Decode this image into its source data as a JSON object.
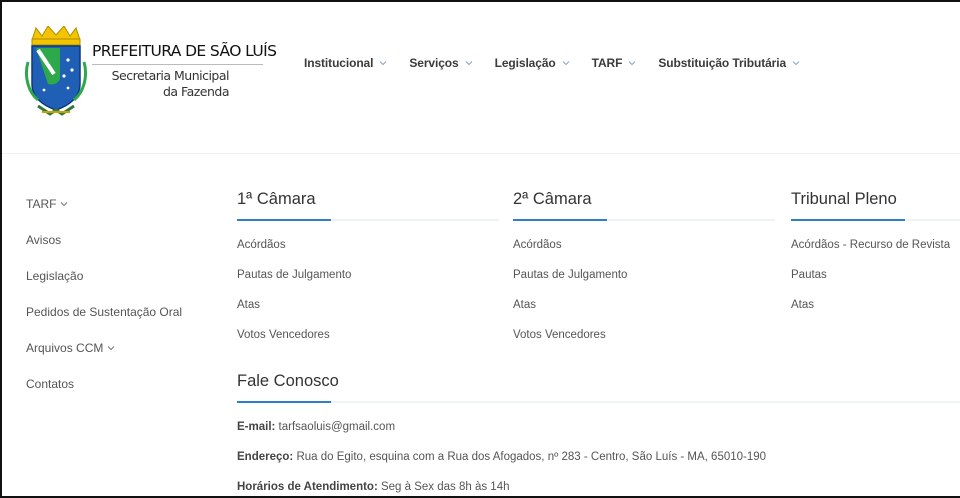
{
  "header": {
    "brand_title": "PREFEITURA DE SÃO LUÍS",
    "brand_sub_1": "Secretaria Municipal",
    "brand_sub_2": "da Fazenda",
    "logo_icon": "sao-luis-coat-of-arms",
    "nav": [
      {
        "label": "Institucional"
      },
      {
        "label": "Serviços"
      },
      {
        "label": "Legislação"
      },
      {
        "label": "TARF"
      },
      {
        "label": "Substituição Tributária"
      }
    ]
  },
  "sidebar": {
    "items": [
      {
        "label": "TARF",
        "has_chevron": true
      },
      {
        "label": "Avisos"
      },
      {
        "label": "Legislação"
      },
      {
        "label": "Pedidos de Sustentação Oral"
      },
      {
        "label": "Arquivos CCM",
        "has_chevron": true
      },
      {
        "label": "Contatos"
      }
    ]
  },
  "columns": [
    {
      "title": "1ª Câmara",
      "links": [
        "Acórdãos",
        "Pautas de Julgamento",
        "Atas",
        "Votos Vencedores"
      ]
    },
    {
      "title": "2ª Câmara",
      "links": [
        "Acórdãos",
        "Pautas de Julgamento",
        "Atas",
        "Votos Vencedores"
      ]
    },
    {
      "title": "Tribunal Pleno",
      "links": [
        "Acórdãos - Recurso de Revista",
        "Pautas",
        "Atas"
      ]
    }
  ],
  "contact": {
    "title": "Fale Conosco",
    "email_label": "E-mail:",
    "email_value": "tarfsaoluis@gmail.com",
    "address_label": "Endereço:",
    "address_value": "Rua do Egito, esquina com a Rua dos Afogados, nº 283 - Centro, São Luís - MA, 65010-190",
    "hours_label": "Horários de Atendimento:",
    "hours_value": "Seg à Sex das 8h às 14h"
  },
  "colors": {
    "accent": "#2f7fc7",
    "text": "#555555",
    "heading": "#333333"
  }
}
